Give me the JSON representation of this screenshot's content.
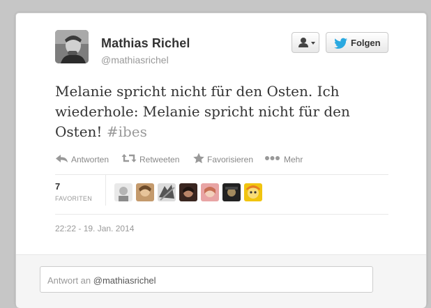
{
  "author": {
    "name": "Mathias Richel",
    "handle": "@mathiasrichel",
    "avatar_icon": "profile-photo"
  },
  "buttons": {
    "user_menu_icon": "user-dropdown-icon",
    "follow_label": "Folgen",
    "follow_icon": "twitter-bird-icon"
  },
  "tweet": {
    "line1": "Melanie spricht nicht für den Osten. Ich",
    "line2": "wiederhole: Melanie spricht nicht für den",
    "line3": "Osten! ",
    "hashtag": "#ibes"
  },
  "actions": {
    "reply": "Antworten",
    "retweet": "Retweeten",
    "favorite": "Favorisieren",
    "more": "Mehr"
  },
  "stats": {
    "favorites_count": "7",
    "favorites_label": "FAVORITEN",
    "favoriters": [
      "avatar-1",
      "avatar-2",
      "avatar-3",
      "avatar-4",
      "avatar-5",
      "avatar-6",
      "avatar-7"
    ]
  },
  "timestamp": "22:22 - 19. Jan. 2014",
  "reply": {
    "placeholder": "Antwort an ",
    "mention": "@mathiasrichel"
  },
  "colors": {
    "backdrop": "#c6c6c6",
    "card": "#ffffff",
    "text_primary": "#333333",
    "text_secondary": "#999999",
    "twitter_blue": "#2aa9e0"
  }
}
